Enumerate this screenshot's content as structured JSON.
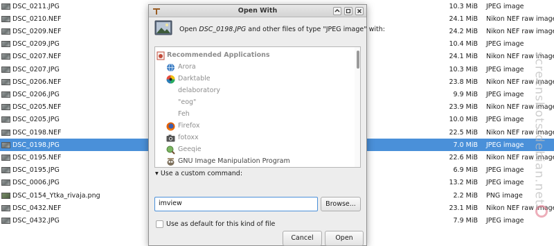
{
  "files": [
    {
      "name": "DSC_0211.JPG",
      "size": "10.3 MiB",
      "type": "JPEG image"
    },
    {
      "name": "DSC_0210.NEF",
      "size": "24.1 MiB",
      "type": "Nikon NEF raw image"
    },
    {
      "name": "DSC_0209.NEF",
      "size": "24.2 MiB",
      "type": "Nikon NEF raw image"
    },
    {
      "name": "DSC_0209.JPG",
      "size": "10.4 MiB",
      "type": "JPEG image"
    },
    {
      "name": "DSC_0207.NEF",
      "size": "24.1 MiB",
      "type": "Nikon NEF raw image"
    },
    {
      "name": "DSC_0207.JPG",
      "size": "10.3 MiB",
      "type": "JPEG image"
    },
    {
      "name": "DSC_0206.NEF",
      "size": "23.8 MiB",
      "type": "Nikon NEF raw image"
    },
    {
      "name": "DSC_0206.JPG",
      "size": "9.9 MiB",
      "type": "JPEG image"
    },
    {
      "name": "DSC_0205.NEF",
      "size": "23.9 MiB",
      "type": "Nikon NEF raw image"
    },
    {
      "name": "DSC_0205.JPG",
      "size": "10.0 MiB",
      "type": "JPEG image"
    },
    {
      "name": "DSC_0198.NEF",
      "size": "22.5 MiB",
      "type": "Nikon NEF raw image"
    },
    {
      "name": "DSC_0198.JPG",
      "size": "7.0 MiB",
      "type": "JPEG image",
      "selected": true
    },
    {
      "name": "DSC_0195.NEF",
      "size": "22.6 MiB",
      "type": "Nikon NEF raw image"
    },
    {
      "name": "DSC_0195.JPG",
      "size": "6.9 MiB",
      "type": "JPEG image"
    },
    {
      "name": "DSC_0006.JPG",
      "size": "13.2 MiB",
      "type": "JPEG image"
    },
    {
      "name": "DSC_0154_Ytka_rivaja.png",
      "size": "2.2 MiB",
      "type": "PNG image"
    },
    {
      "name": "DSC_0432.NEF",
      "size": "23.1 MiB",
      "type": "Nikon NEF raw image"
    },
    {
      "name": "DSC_0432.JPG",
      "size": "7.9 MiB",
      "type": "JPEG image"
    }
  ],
  "colors": {
    "selection": "#4a90d9",
    "dialog_bg": "#ededed"
  },
  "dialog": {
    "title": "Open With",
    "app_icon": "open-with-icon",
    "header_prefix": "Open ",
    "header_file": "DSC_0198.JPG",
    "header_suffix": " and other files of type \"JPEG image\" with:",
    "section_label": "Recommended Applications",
    "apps": [
      {
        "name": "Arora",
        "icon": "globe-icon"
      },
      {
        "name": "Darktable",
        "icon": "darktable-icon"
      },
      {
        "name": "delaboratory",
        "icon": ""
      },
      {
        "name": "\"eog\"",
        "icon": ""
      },
      {
        "name": "Feh",
        "icon": ""
      },
      {
        "name": "Firefox",
        "icon": "firefox-icon"
      },
      {
        "name": "fotoxx",
        "icon": "camera-icon"
      },
      {
        "name": "Geeqie",
        "icon": "geeqie-icon"
      },
      {
        "name": "GNU Image Manipulation Program",
        "icon": "gimp-icon"
      }
    ],
    "custom_command_label": "Use a custom command:",
    "custom_command_value": "imview",
    "browse_label": "Browse...",
    "default_label": "Use as default for this kind of file",
    "cancel_label": "Cancel",
    "open_label": "Open"
  },
  "watermark": "screenshots.debian.net"
}
